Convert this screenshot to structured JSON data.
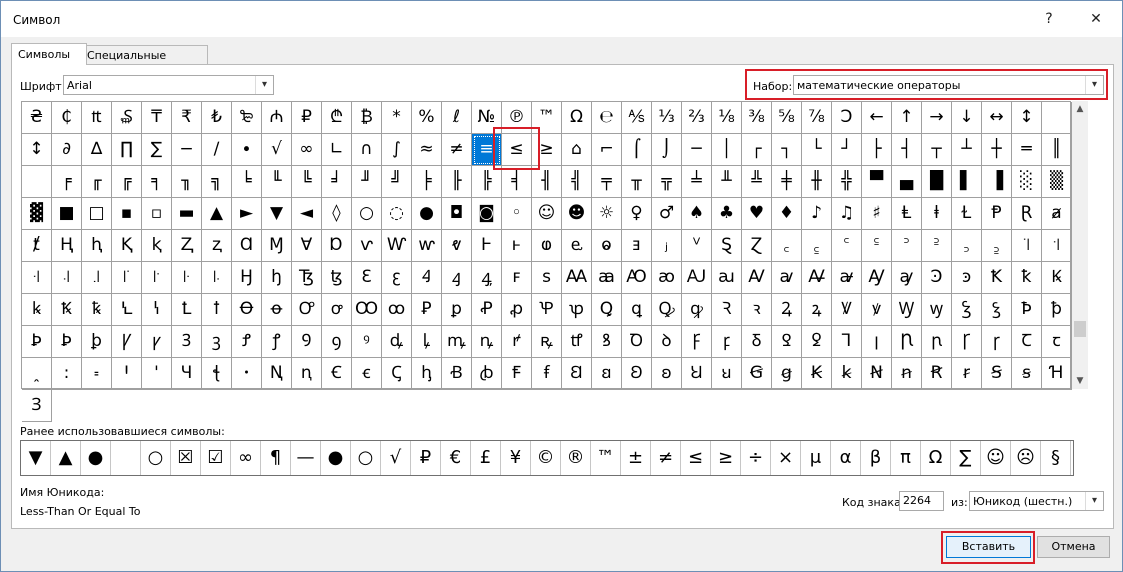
{
  "window": {
    "title": "Символ",
    "help_label": "?",
    "close_label": "✕"
  },
  "tabs": [
    {
      "label": "Символы"
    },
    {
      "label": "Специальные знаки"
    }
  ],
  "font": {
    "label": "Шрифт:",
    "value": "Arial"
  },
  "subset": {
    "label": "Набор:",
    "value": "математические операторы"
  },
  "symbol_grid": {
    "selected_index": 50,
    "cells": [
      "₴",
      "₵",
      "₶",
      "₷",
      "₸",
      "₹",
      "₺",
      "₻",
      "₼",
      "₽",
      "₾",
      "₿",
      "*",
      "%",
      "ℓ",
      "№",
      "℗",
      "™",
      "Ω",
      "℮",
      "⅍",
      "⅓",
      "⅔",
      "⅛",
      "⅜",
      "⅝",
      "⅞",
      "Ↄ",
      "←",
      "↑",
      "→",
      "↓",
      "↔",
      "↕",
      "",
      "↕",
      "∂",
      "∆",
      "∏",
      "∑",
      "−",
      "∕",
      "∙",
      "√",
      "∞",
      "∟",
      "∩",
      "∫",
      "≈",
      "≠",
      "≡",
      "≤",
      "≥",
      "⌂",
      "⌐",
      "⌠",
      "⌡",
      "─",
      "│",
      "┌",
      "┐",
      "└",
      "┘",
      "├",
      "┤",
      "┬",
      "┴",
      "┼",
      "═",
      "║",
      "",
      "╒",
      "╓",
      "╔",
      "╕",
      "╖",
      "╗",
      "╘",
      "╙",
      "╚",
      "╛",
      "╜",
      "╝",
      "╞",
      "╟",
      "╠",
      "╡",
      "╢",
      "╣",
      "╤",
      "╥",
      "╦",
      "╧",
      "╨",
      "╩",
      "╪",
      "╫",
      "╬",
      "▀",
      "▄",
      "█",
      "▌",
      "▐",
      "░",
      "▒",
      "▓",
      "■",
      "□",
      "▪",
      "▫",
      "▬",
      "▲",
      "►",
      "▼",
      "◄",
      "◊",
      "○",
      "◌",
      "●",
      "◘",
      "◙",
      "◦",
      "☺",
      "☻",
      "☼",
      "♀",
      "♂",
      "♠",
      "♣",
      "♥",
      "♦",
      "♪",
      "♫",
      "♯",
      "Ⱡ",
      "ⱡ",
      "Ɫ",
      "Ᵽ",
      "Ɽ",
      "ⱥ",
      "ⱦ",
      "Ⱨ",
      "ⱨ",
      "Ⱪ",
      "ⱪ",
      "Ⱬ",
      "ⱬ",
      "Ɑ",
      "Ɱ",
      "Ɐ",
      "Ɒ",
      "ⱱ",
      "Ⱳ",
      "ⱳ",
      "ⱴ",
      "Ⱶ",
      "ⱶ",
      "ⱷ",
      "ⱸ",
      "ⱺ",
      "ⱻ",
      "ⱼ",
      "ⱽ",
      "Ȿ",
      "Ɀ",
      "꜀",
      "꜁",
      "꜂",
      "꜃",
      "꜄",
      "꜅",
      "꜆",
      "꜇",
      "꜈",
      "꜉",
      "꜊",
      "꜋",
      "꜌",
      "꜍",
      "꜎",
      "꜏",
      "꜐",
      "Ꜧ",
      "ꜧ",
      "Ꜩ",
      "ꜩ",
      "Ꜫ",
      "ꜫ",
      "Ꜭ",
      "ꜭ",
      "ꜯ",
      "ꜰ",
      "ꜱ",
      "Ꜳ",
      "ꜳ",
      "Ꜵ",
      "ꜵ",
      "Ꜷ",
      "ꜷ",
      "Ꜹ",
      "ꜹ",
      "Ꜻ",
      "ꜻ",
      "Ꜽ",
      "ꜽ",
      "Ꜿ",
      "ꜿ",
      "Ꝁ",
      "ꝁ",
      "Ꝃ",
      "ꝃ",
      "Ꝅ",
      "ꝅ",
      "Ꝇ",
      "ꝇ",
      "Ꝉ",
      "ꝉ",
      "Ꝋ",
      "ꝋ",
      "Ꝍ",
      "ꝍ",
      "Ꝏ",
      "ꝏ",
      "Ꝑ",
      "ꝑ",
      "Ꝓ",
      "ꝓ",
      "Ꝕ",
      "ꝕ",
      "Ꝗ",
      "ꝗ",
      "Ꝙ",
      "ꝙ",
      "Ꝛ",
      "ꝛ",
      "Ꝝ",
      "ꝝ",
      "Ꝟ",
      "ꝟ",
      "Ꝡ",
      "ꝡ",
      "Ꝣ",
      "ꝣ",
      "Ꝥ",
      "ꝥ",
      "Ꝧ",
      "Ꝧ",
      "ꝧ",
      "Ꝩ",
      "ꝩ",
      "Ꝫ",
      "ꝫ",
      "Ꝭ",
      "ꝭ",
      "Ꝯ",
      "ꝯ",
      "ꝰ",
      "ꝱ",
      "ꝲ",
      "ꝳ",
      "ꝴ",
      "ꝵ",
      "ꝶ",
      "ꝷ",
      "ꝸ",
      "Ꝺ",
      "ꝺ",
      "Ꝼ",
      "ꝼ",
      "Ᵹ",
      "Ꝿ",
      "ꝿ",
      "Ꞁ",
      "ꞁ",
      "Ꞃ",
      "ꞃ",
      "Ꞅ",
      "ꞅ",
      "Ꞇ",
      "ꞇ",
      "ꞈ",
      "꞉",
      "꞊",
      "Ꞌ",
      "ꞌ",
      "Ɥ",
      "ꞎ",
      "ꞏ",
      "Ꞑ",
      "ꞑ",
      "Ꞓ",
      "ꞓ",
      "Ꞔ",
      "ꞕ",
      "Ꞗ",
      "ꞗ",
      "Ꞙ",
      "ꞙ",
      "Ꞛ",
      "ꞛ",
      "Ꞝ",
      "ꞝ",
      "Ꞟ",
      "ꞟ",
      "Ꞡ",
      "ꞡ",
      "Ꞣ",
      "ꞣ",
      "Ꞥ",
      "ꞥ",
      "Ꞧ",
      "ꞧ",
      "Ꞩ",
      "ꞩ",
      "Ɦ",
      "Ɜ"
    ]
  },
  "recent": {
    "label": "Ранее использовавшиеся символы:",
    "symbols": [
      "▼",
      "▲",
      "●",
      "",
      "○",
      "☒",
      "☑",
      "∞",
      "¶",
      "—",
      "●",
      "○",
      "√",
      "₽",
      "€",
      "£",
      "¥",
      "©",
      "®",
      "™",
      "±",
      "≠",
      "≤",
      "≥",
      "÷",
      "×",
      "μ",
      "α",
      "β",
      "π",
      "Ω",
      "∑",
      "☺",
      "☹",
      "§"
    ]
  },
  "unicode_name": {
    "label": "Имя Юникода:",
    "value": "Less-Than Or Equal To"
  },
  "char_code": {
    "label": "Код знака:",
    "value": "2264"
  },
  "from": {
    "label": "из:",
    "value": "Юникод (шестн.)"
  },
  "buttons": {
    "insert": "Вставить",
    "cancel": "Отмена"
  },
  "colors": {
    "selection": "#0078d7",
    "highlight": "#d81e28"
  }
}
